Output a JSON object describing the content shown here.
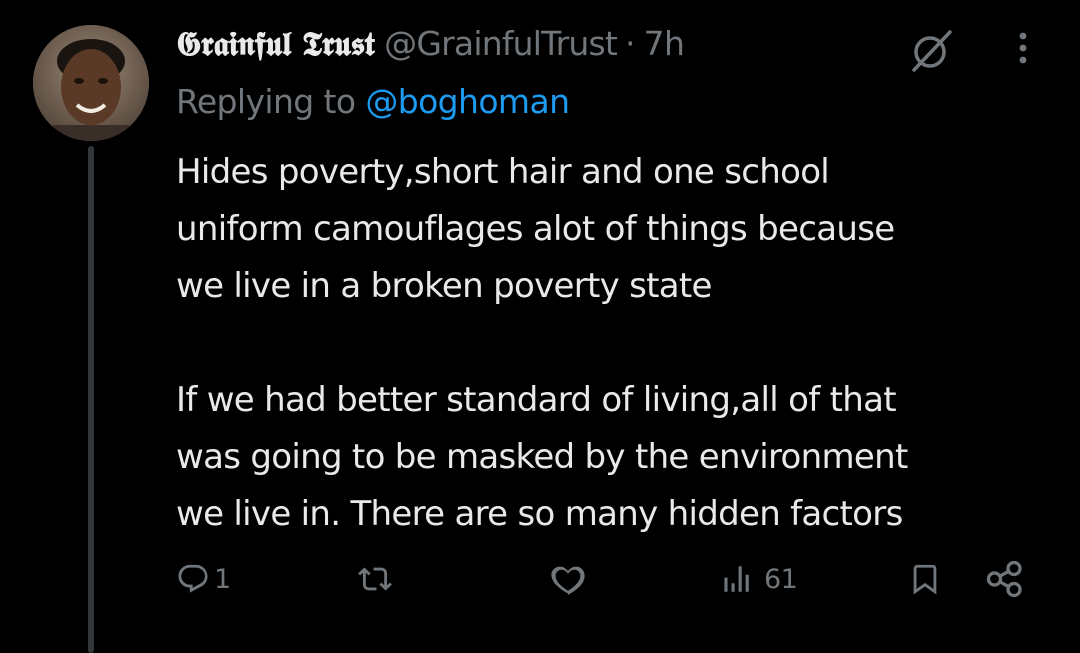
{
  "tweet": {
    "author": {
      "display_name": "𝕲𝖗𝖆𝖎𝖓𝖋𝖚𝖑 𝕿𝖗𝖚𝖘𝖙",
      "handle": "@GrainfulTrust",
      "separator": "·",
      "time": "7h"
    },
    "reply": {
      "prefix": "Replying to ",
      "mention": "@boghoman"
    },
    "paragraphs": [
      "Hides poverty,short hair and one school\nuniform camouflages alot of things because\nwe live in a broken poverty state",
      "If we had better standard of living,all of that\nwas going to be masked by the environment\nwe live in. There are so many hidden factors"
    ],
    "actions": {
      "replies": "1",
      "reposts": "",
      "likes": "",
      "views": "61"
    }
  },
  "icons": {
    "header": [
      "grok-icon",
      "more-icon"
    ],
    "actions": [
      "reply-icon",
      "repost-icon",
      "like-icon",
      "views-icon",
      "bookmark-icon",
      "share-icon"
    ]
  },
  "colors": {
    "background": "#000000",
    "primary_text": "#e7e9ea",
    "secondary_text": "#71767b",
    "link": "#1d9bf0",
    "thread_line": "#333639"
  }
}
